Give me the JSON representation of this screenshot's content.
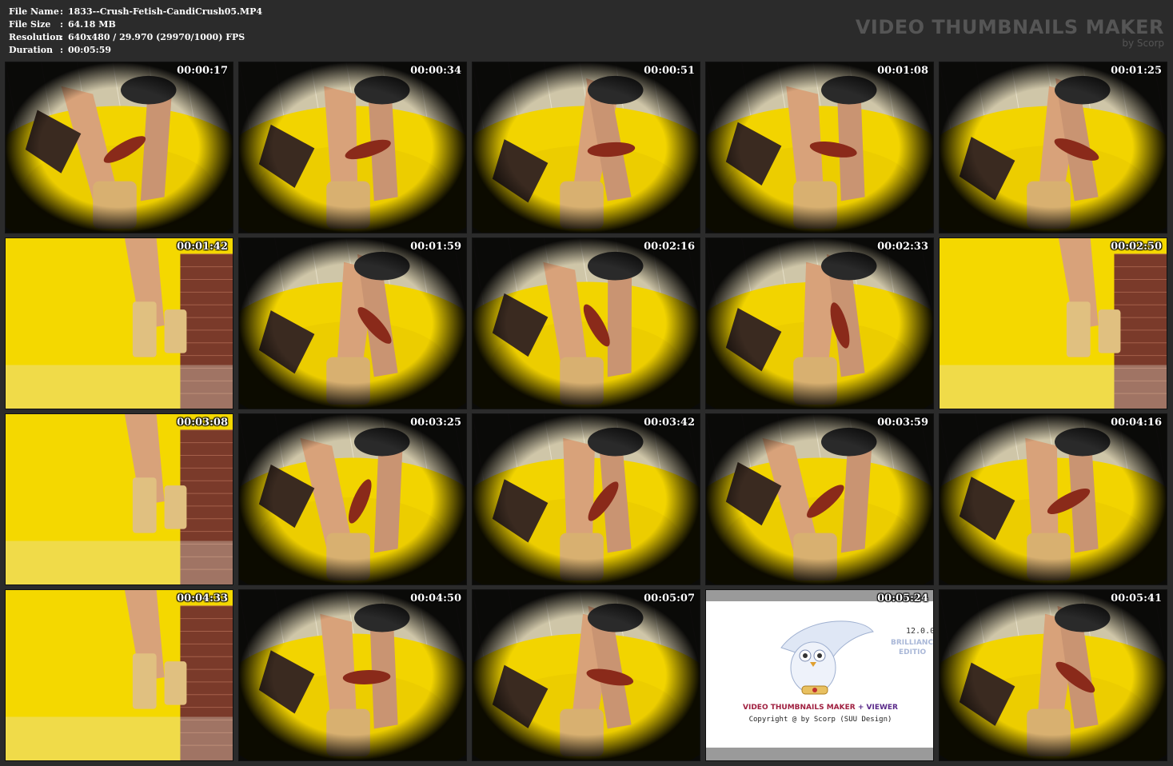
{
  "info": [
    {
      "key": "File Name",
      "value": "1833--Crush-Fetish-CandiCrush05.MP4"
    },
    {
      "key": "File Size",
      "value": "64.18 MB"
    },
    {
      "key": "Resolution",
      "value": "640x480 / 29.970 (29970/1000) FPS"
    },
    {
      "key": "Duration",
      "value": "00:05:59"
    }
  ],
  "info_sep": ":",
  "brand": {
    "title": "VIDEO THUMBNAILS MAKER",
    "sub": "by Scorp"
  },
  "thumbnails": [
    {
      "time": "00:00:17",
      "scene": "fisheye-yellow"
    },
    {
      "time": "00:00:34",
      "scene": "fisheye-yellow"
    },
    {
      "time": "00:00:51",
      "scene": "fisheye-yellow"
    },
    {
      "time": "00:01:08",
      "scene": "fisheye-yellow"
    },
    {
      "time": "00:01:25",
      "scene": "fisheye-yellow"
    },
    {
      "time": "00:01:42",
      "scene": "wide-yellow"
    },
    {
      "time": "00:01:59",
      "scene": "fisheye-yellow"
    },
    {
      "time": "00:02:16",
      "scene": "fisheye-yellow"
    },
    {
      "time": "00:02:33",
      "scene": "fisheye-yellow"
    },
    {
      "time": "00:02:50",
      "scene": "wide-yellow"
    },
    {
      "time": "00:03:08",
      "scene": "wide-yellow"
    },
    {
      "time": "00:03:25",
      "scene": "fisheye-yellow"
    },
    {
      "time": "00:03:42",
      "scene": "fisheye-yellow"
    },
    {
      "time": "00:03:59",
      "scene": "fisheye-yellow"
    },
    {
      "time": "00:04:16",
      "scene": "fisheye-yellow"
    },
    {
      "time": "00:04:33",
      "scene": "wide-yellow"
    },
    {
      "time": "00:04:50",
      "scene": "fisheye-yellow"
    },
    {
      "time": "00:05:07",
      "scene": "fisheye-yellow"
    },
    {
      "time": "00:05:24",
      "scene": "splash"
    },
    {
      "time": "00:05:41",
      "scene": "fisheye-yellow"
    }
  ],
  "splash": {
    "version": "12.0.0.",
    "edition_line1": "BRILLIANC",
    "edition_line2": "EDITIO",
    "product_part1": "VIDEO THUMBNAILS MAKER",
    "product_plus": " + ",
    "product_part2": "VIEWER",
    "copyright": "Copyright @ by Scorp (SUU Design)"
  },
  "colors": {
    "background": "#2b2b2b",
    "floor_yellow": "#f2d400",
    "wall_tile": "#d9d2b8",
    "brand_gray": "#555555"
  }
}
